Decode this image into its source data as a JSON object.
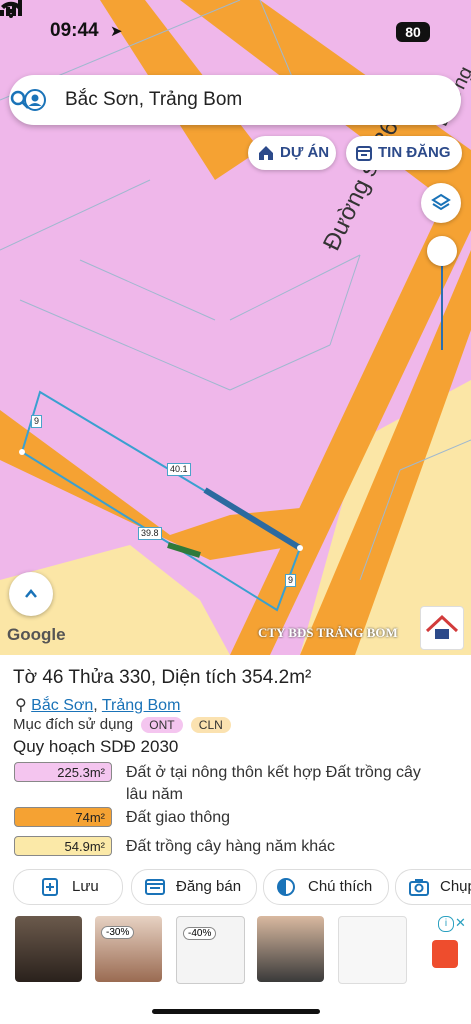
{
  "status": {
    "time": "09:44",
    "battery": "80"
  },
  "search": {
    "text": "Bắc Sơn, Trảng Bom"
  },
  "chips": {
    "project": "DỰ ÁN",
    "listing": "TIN ĐĂNG"
  },
  "map": {
    "road_name": "Đường số 36",
    "road_name_partial": "Đường",
    "dims": {
      "top": "40.1",
      "bottom": "39.8",
      "left": "9",
      "right": "9"
    },
    "google_label": "Google",
    "watermark": "CTY BĐS TRẢNG BOM",
    "colors": {
      "residential": "#efb7ea",
      "road": "#f5a233",
      "crop": "#fbe6a6",
      "parcel": "#3aa0d0"
    }
  },
  "parcel": {
    "title": "Tờ 46 Thửa 330, Diện tích 354.2m²",
    "ward": "Bắc Sơn",
    "district": "Trảng Bom",
    "purpose_label": "Mục đích sử dụng",
    "tags": [
      "ONT",
      "CLN"
    ],
    "plan_label": "Quy hoạch SDĐ 2030",
    "areas": [
      {
        "value": "225.3m²",
        "text": "Đất ở tại nông thôn kết hợp Đất trồng cây lâu năm",
        "color": "#f4c5ef"
      },
      {
        "value": "74m²",
        "text": "Đất giao thông",
        "color": "#f5a233"
      },
      {
        "value": "54.9m²",
        "text": "Đất trồng cây hàng năm khác",
        "color": "#fbe9a8"
      }
    ]
  },
  "actions": {
    "save": "Lưu",
    "post": "Đăng bán",
    "legend": "Chú thích",
    "capture": "Chụp"
  },
  "ads": {
    "discounts": [
      "-30%",
      "-40%"
    ]
  }
}
